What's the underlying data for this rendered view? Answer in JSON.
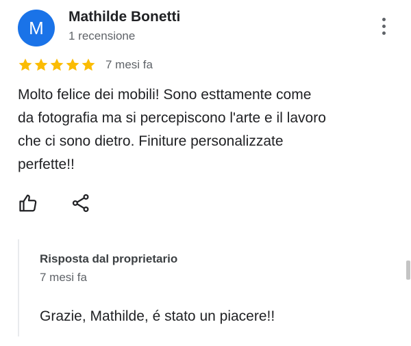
{
  "review": {
    "avatar_initial": "M",
    "avatar_color": "#1a73e8",
    "reviewer_name": "Mathilde Bonetti",
    "reviewer_meta": "1 recensione",
    "rating": 5,
    "rating_max": 5,
    "star_color": "#fbbc04",
    "date": "7 mesi fa",
    "text": "Molto felice dei mobili! Sono esttamente come\nda fotografia ma si percepiscono l'arte e il lavoro\nche ci sono dietro.  Finiture personalizzate\nperfette!!",
    "more_icon": "more-vertical-icon",
    "like_icon": "thumb-up-icon",
    "share_icon": "share-icon"
  },
  "owner_reply": {
    "heading": "Risposta dal proprietario",
    "date": "7 mesi fa",
    "text": "Grazie, Mathilde, é stato un piacere!!"
  }
}
